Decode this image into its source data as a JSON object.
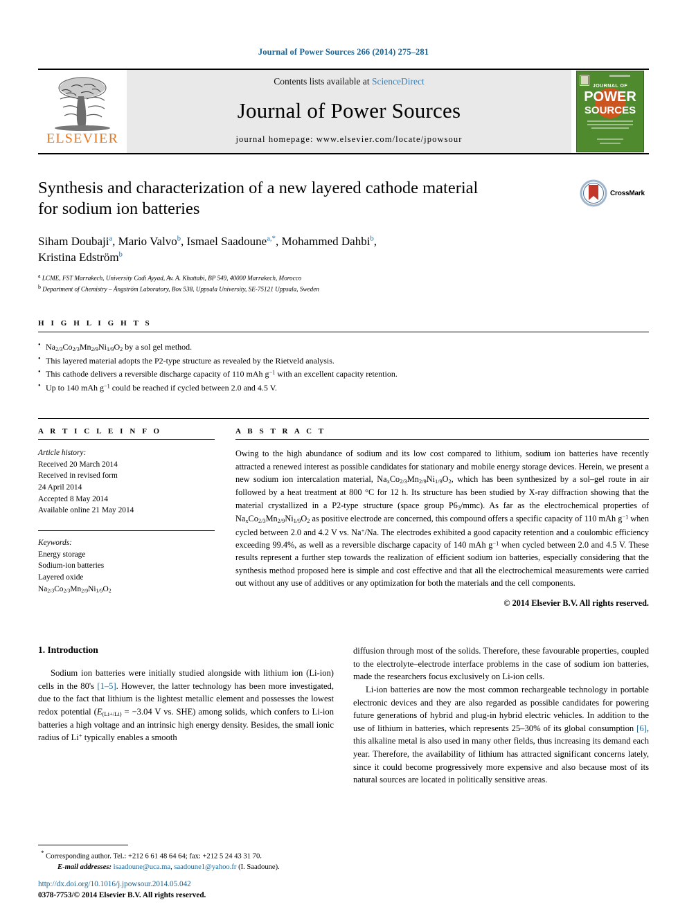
{
  "runhead": "Journal of Power Sources 266 (2014) 275–281",
  "masthead": {
    "publisher": "ELSEVIER",
    "contents_prefix": "Contents lists available at ",
    "contents_link": "ScienceDirect",
    "journal_name": "Journal of Power Sources",
    "homepage": "journal homepage: www.elsevier.com/locate/jpowsour",
    "cover_line1": "JOURNAL OF",
    "cover_line2": "POWER",
    "cover_line3": "SOURCES",
    "cover_green": "#4f8a2e",
    "link_color": "#3a7fb5"
  },
  "article": {
    "title_line1": "Synthesis and characterization of a new layered cathode material",
    "title_line2": "for sodium ion batteries",
    "crossmark_label": "CrossMark",
    "authors": [
      {
        "name": "Siham Doubaji",
        "marks": "a",
        "star": false
      },
      {
        "name": "Mario Valvo",
        "marks": "b",
        "star": false
      },
      {
        "name": "Ismael Saadoune",
        "marks": "a,",
        "star": true
      },
      {
        "name": "Mohammed Dahbi",
        "marks": "b",
        "star": false
      },
      {
        "name": "Kristina Edström",
        "marks": "b",
        "star": false
      }
    ],
    "affiliations": [
      {
        "mark": "a",
        "text": "LCME, FST Marrakech, University Cadi Ayyad, Av. A. Khattabi, BP 549, 40000 Marrakech, Morocco"
      },
      {
        "mark": "b",
        "text": "Department of Chemistry – Ångström Laboratory, Box 538, Uppsala University, SE-75121 Uppsala, Sweden"
      }
    ]
  },
  "highlights": {
    "label": "H I G H L I G H T S",
    "items": [
      "Na2/3Co2/3Mn2/9Ni1/9O2 by a sol gel method.",
      "This layered material adopts the P2-type structure as revealed by the Rietveld analysis.",
      "This cathode delivers a reversible discharge capacity of 110 mAh g−1 with an excellent capacity retention.",
      "Up to 140 mAh g−1 could be reached if cycled between 2.0 and 4.5 V."
    ]
  },
  "article_info": {
    "label": "A R T I C L E   I N F O",
    "history_label": "Article history:",
    "history": [
      "Received 20 March 2014",
      "Received in revised form",
      "24 April 2014",
      "Accepted 8 May 2014",
      "Available online 21 May 2014"
    ],
    "keywords_label": "Keywords:",
    "keywords": [
      "Energy storage",
      "Sodium-ion batteries",
      "Layered oxide",
      "Na2/3Co2/3Mn2/9Ni1/9O2"
    ]
  },
  "abstract": {
    "label": "A B S T R A C T",
    "text": "Owing to the high abundance of sodium and its low cost compared to lithium, sodium ion batteries have recently attracted a renewed interest as possible candidates for stationary and mobile energy storage devices. Herein, we present a new sodium ion intercalation material, NaxCo2/3Mn2/9Ni1/9O2, which has been synthesized by a sol–gel route in air followed by a heat treatment at 800 °C for 12 h. Its structure has been studied by X-ray diffraction showing that the material crystallized in a P2-type structure (space group P63/mmc). As far as the electrochemical properties of NaxCo2/3Mn2/9Ni1/9O2 as positive electrode are concerned, this compound offers a specific capacity of 110 mAh g−1 when cycled between 2.0 and 4.2 V vs. Na+/Na. The electrodes exhibited a good capacity retention and a coulombic efficiency exceeding 99.4%, as well as a reversible discharge capacity of 140 mAh g−1 when cycled between 2.0 and 4.5 V. These results represent a further step towards the realization of efficient sodium ion batteries, especially considering that the synthesis method proposed here is simple and cost effective and that all the electrochemical measurements were carried out without any use of additives or any optimization for both the materials and the cell components.",
    "copyright": "© 2014 Elsevier B.V. All rights reserved."
  },
  "introduction": {
    "heading": "1.  Introduction",
    "left_paragraph_1": "Sodium ion batteries were initially studied alongside with lithium ion (Li-ion) cells in the 80's [1–5]. However, the latter technology has been more investigated, due to the fact that lithium is the lightest metallic element and possesses the lowest redox potential (E(Li+/Li) = −3.04 V vs. SHE) among solids, which confers to Li-ion batteries a high voltage and an intrinsic high energy density. Besides, the small ionic radius of Li+ typically enables a smooth",
    "right_paragraph_1": "diffusion through most of the solids. Therefore, these favourable properties, coupled to the electrolyte–electrode interface problems in the case of sodium ion batteries, made the researchers focus exclusively on Li-ion cells.",
    "right_paragraph_2": "Li-ion batteries are now the most common rechargeable technology in portable electronic devices and they are also regarded as possible candidates for powering future generations of hybrid and plug-in hybrid electric vehicles. In addition to the use of lithium in batteries, which represents 25–30% of its global consumption [6], this alkaline metal is also used in many other fields, thus increasing its demand each year. Therefore, the availability of lithium has attracted significant concerns lately, since it could become progressively more expensive and also because most of its natural sources are located in politically sensitive areas.",
    "ref_1": "[1–5]",
    "ref_6": "[6]"
  },
  "footnote": {
    "star": "*",
    "corresponding": "Corresponding author. Tel.: +212 6 61 48 64 64; fax: +212 5 24 43 31 70.",
    "email_label": "E-mail addresses:",
    "email1": "isaadoune@uca.ma",
    "email2": "saadoune1@yahoo.fr",
    "email_suffix": "(I. Saadoune)."
  },
  "bottom": {
    "doi": "http://dx.doi.org/10.1016/j.jpowsour.2014.05.042",
    "issn": "0378-7753/",
    "issn_rest": "© 2014 Elsevier B.V. All rights reserved."
  }
}
